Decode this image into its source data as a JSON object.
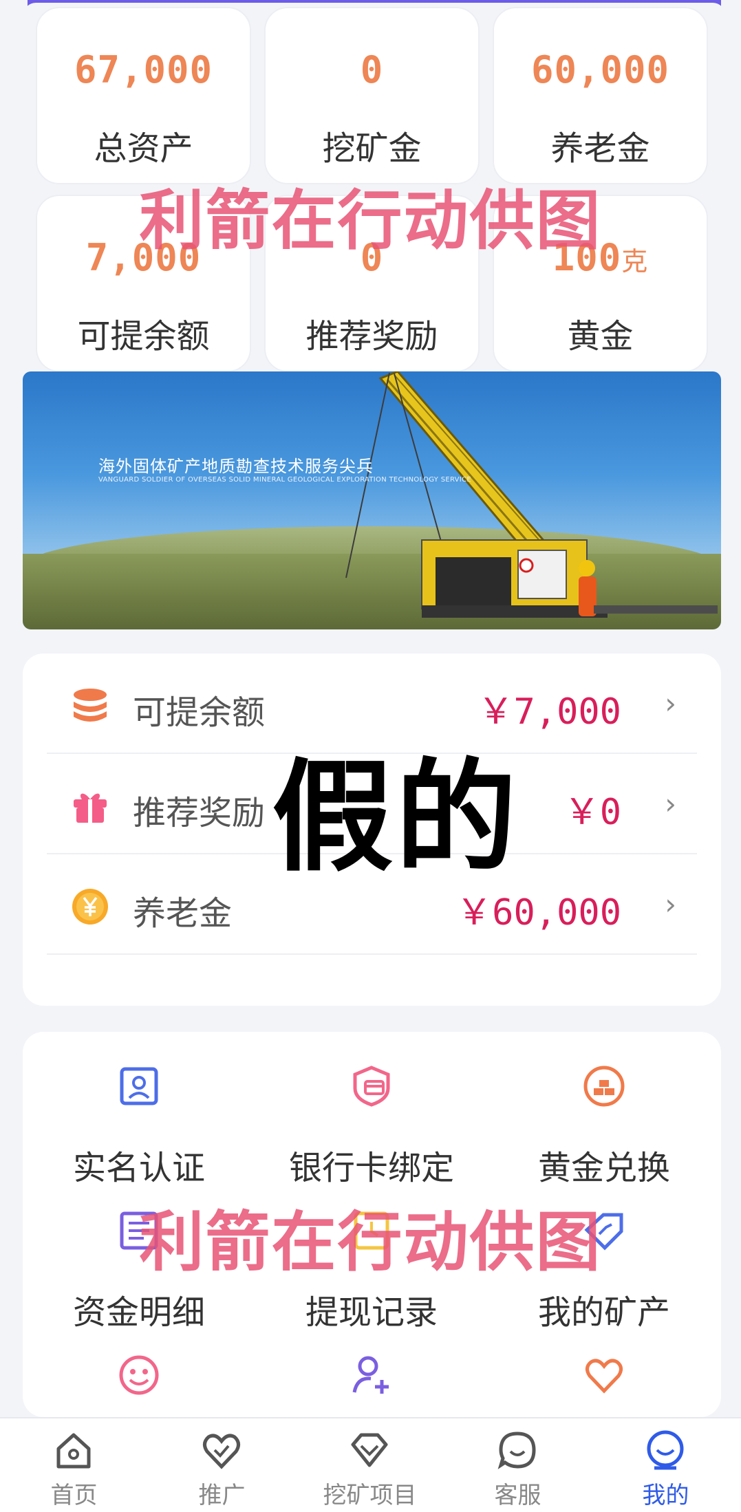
{
  "stats": [
    {
      "value": "67,000",
      "unit": "",
      "label": "总资产"
    },
    {
      "value": "0",
      "unit": "",
      "label": "挖矿金"
    },
    {
      "value": "60,000",
      "unit": "",
      "label": "养老金"
    },
    {
      "value": "7,000",
      "unit": "",
      "label": "可提余额"
    },
    {
      "value": "0",
      "unit": "",
      "label": "推荐奖励"
    },
    {
      "value": "100",
      "unit": "克",
      "label": "黄金"
    }
  ],
  "watermark_text": "利箭在行动供图",
  "banner": {
    "title": "海外固体矿产地质勘查技术服务尖兵",
    "subtitle": "VANGUARD SOLDIER OF OVERSEAS SOLID MINERAL GEOLOGICAL EXPLORATION TECHNOLOGY SERVICE"
  },
  "balances": [
    {
      "label": "可提余额",
      "value": "￥7,000",
      "icon": "coins-stack-icon"
    },
    {
      "label": "推荐奖励",
      "value": "￥0",
      "icon": "gift-icon"
    },
    {
      "label": "养老金",
      "value": "￥60,000",
      "icon": "yen-coin-icon"
    }
  ],
  "overlay_text": "假的",
  "features": [
    {
      "label": "实名认证",
      "icon": "id-card-icon"
    },
    {
      "label": "银行卡绑定",
      "icon": "bank-card-shield-icon"
    },
    {
      "label": "黄金兑换",
      "icon": "gold-bars-icon"
    },
    {
      "label": "资金明细",
      "icon": "document-list-icon"
    },
    {
      "label": "提现记录",
      "icon": "withdraw-record-icon"
    },
    {
      "label": "我的矿产",
      "icon": "diamond-tag-icon"
    },
    {
      "label": "",
      "icon": "smiley-face-icon"
    },
    {
      "label": "",
      "icon": "add-user-icon"
    },
    {
      "label": "",
      "icon": "heart-icon"
    }
  ],
  "nav": [
    {
      "label": "首页",
      "icon": "home-icon"
    },
    {
      "label": "推广",
      "icon": "heart-check-icon"
    },
    {
      "label": "挖矿项目",
      "icon": "diamond-icon"
    },
    {
      "label": "客服",
      "icon": "chat-icon"
    },
    {
      "label": "我的",
      "icon": "profile-icon",
      "active": true
    }
  ],
  "colors": {
    "accent_orange": "#ee8655",
    "value_red": "#d81e5b",
    "nav_active": "#2f5be8",
    "watermark": "#e85474",
    "header_purple": "#6c5ce7"
  }
}
